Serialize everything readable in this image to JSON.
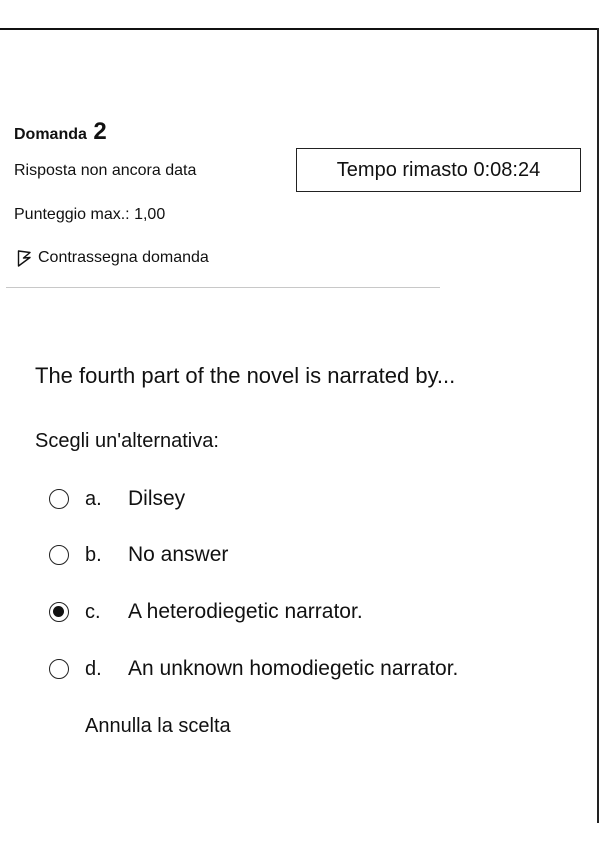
{
  "question_info": {
    "title_label": "Domanda",
    "number": "2",
    "status": "Risposta non ancora data",
    "max_score": "Punteggio max.: 1,00",
    "flag_label": "Contrassegna domanda"
  },
  "timer": {
    "text": "Tempo rimasto 0:08:24"
  },
  "question": {
    "text": "The fourth part of the novel is narrated by...",
    "prompt": "Scegli un'alternativa:",
    "options": [
      {
        "letter": "a.",
        "label": "Dilsey",
        "selected": false
      },
      {
        "letter": "b.",
        "label": "No answer",
        "selected": false
      },
      {
        "letter": "c.",
        "label": "A heterodiegetic narrator.",
        "selected": true
      },
      {
        "letter": "d.",
        "label": "An unknown homodiegetic narrator.",
        "selected": false
      }
    ],
    "clear_label": "Annulla la scelta"
  },
  "icons": {
    "flag": "flag-icon",
    "radio": "radio-icon"
  }
}
